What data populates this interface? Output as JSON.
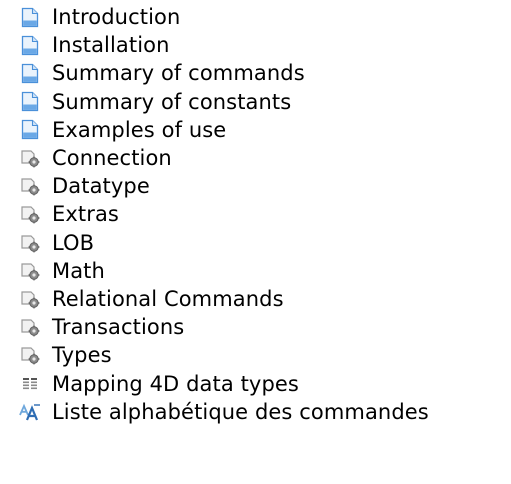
{
  "toc": {
    "items": [
      {
        "label": "Introduction",
        "icon": "page-icon"
      },
      {
        "label": "Installation",
        "icon": "page-icon"
      },
      {
        "label": "Summary of commands",
        "icon": "page-icon"
      },
      {
        "label": "Summary of constants",
        "icon": "page-icon"
      },
      {
        "label": "Examples of use",
        "icon": "page-icon"
      },
      {
        "label": "Connection",
        "icon": "command-theme-icon"
      },
      {
        "label": "Datatype",
        "icon": "command-theme-icon"
      },
      {
        "label": "Extras",
        "icon": "command-theme-icon"
      },
      {
        "label": "LOB",
        "icon": "command-theme-icon"
      },
      {
        "label": "Math",
        "icon": "command-theme-icon"
      },
      {
        "label": "Relational Commands",
        "icon": "command-theme-icon"
      },
      {
        "label": "Transactions",
        "icon": "command-theme-icon"
      },
      {
        "label": "Types",
        "icon": "command-theme-icon"
      },
      {
        "label": "Mapping 4D data types",
        "icon": "table-icon"
      },
      {
        "label": "Liste alphabétique des commandes",
        "icon": "alphabetical-icon"
      }
    ]
  },
  "colors": {
    "page_blue": "#4a90d9",
    "gear_gray": "#8c8c8c",
    "alpha_blue": "#3f7fc0"
  }
}
